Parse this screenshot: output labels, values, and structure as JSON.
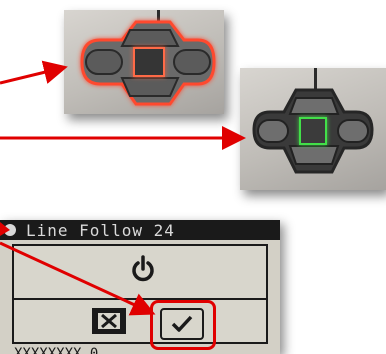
{
  "lcd": {
    "title": "Line Follow 24",
    "bottom_text": "XXXXXXXX 0",
    "buttons": {
      "cancel": "cancel-x",
      "confirm": "check"
    }
  },
  "colors": {
    "arrow_red": "#e00000",
    "glow_red": "#ff4a2e",
    "glow_green": "#43e048",
    "lcd_bg": "#d3d0c6",
    "lcd_dark": "#1a1a1a"
  },
  "icons": {
    "power": "power-icon",
    "cancel": "x-icon",
    "confirm": "check-icon"
  }
}
